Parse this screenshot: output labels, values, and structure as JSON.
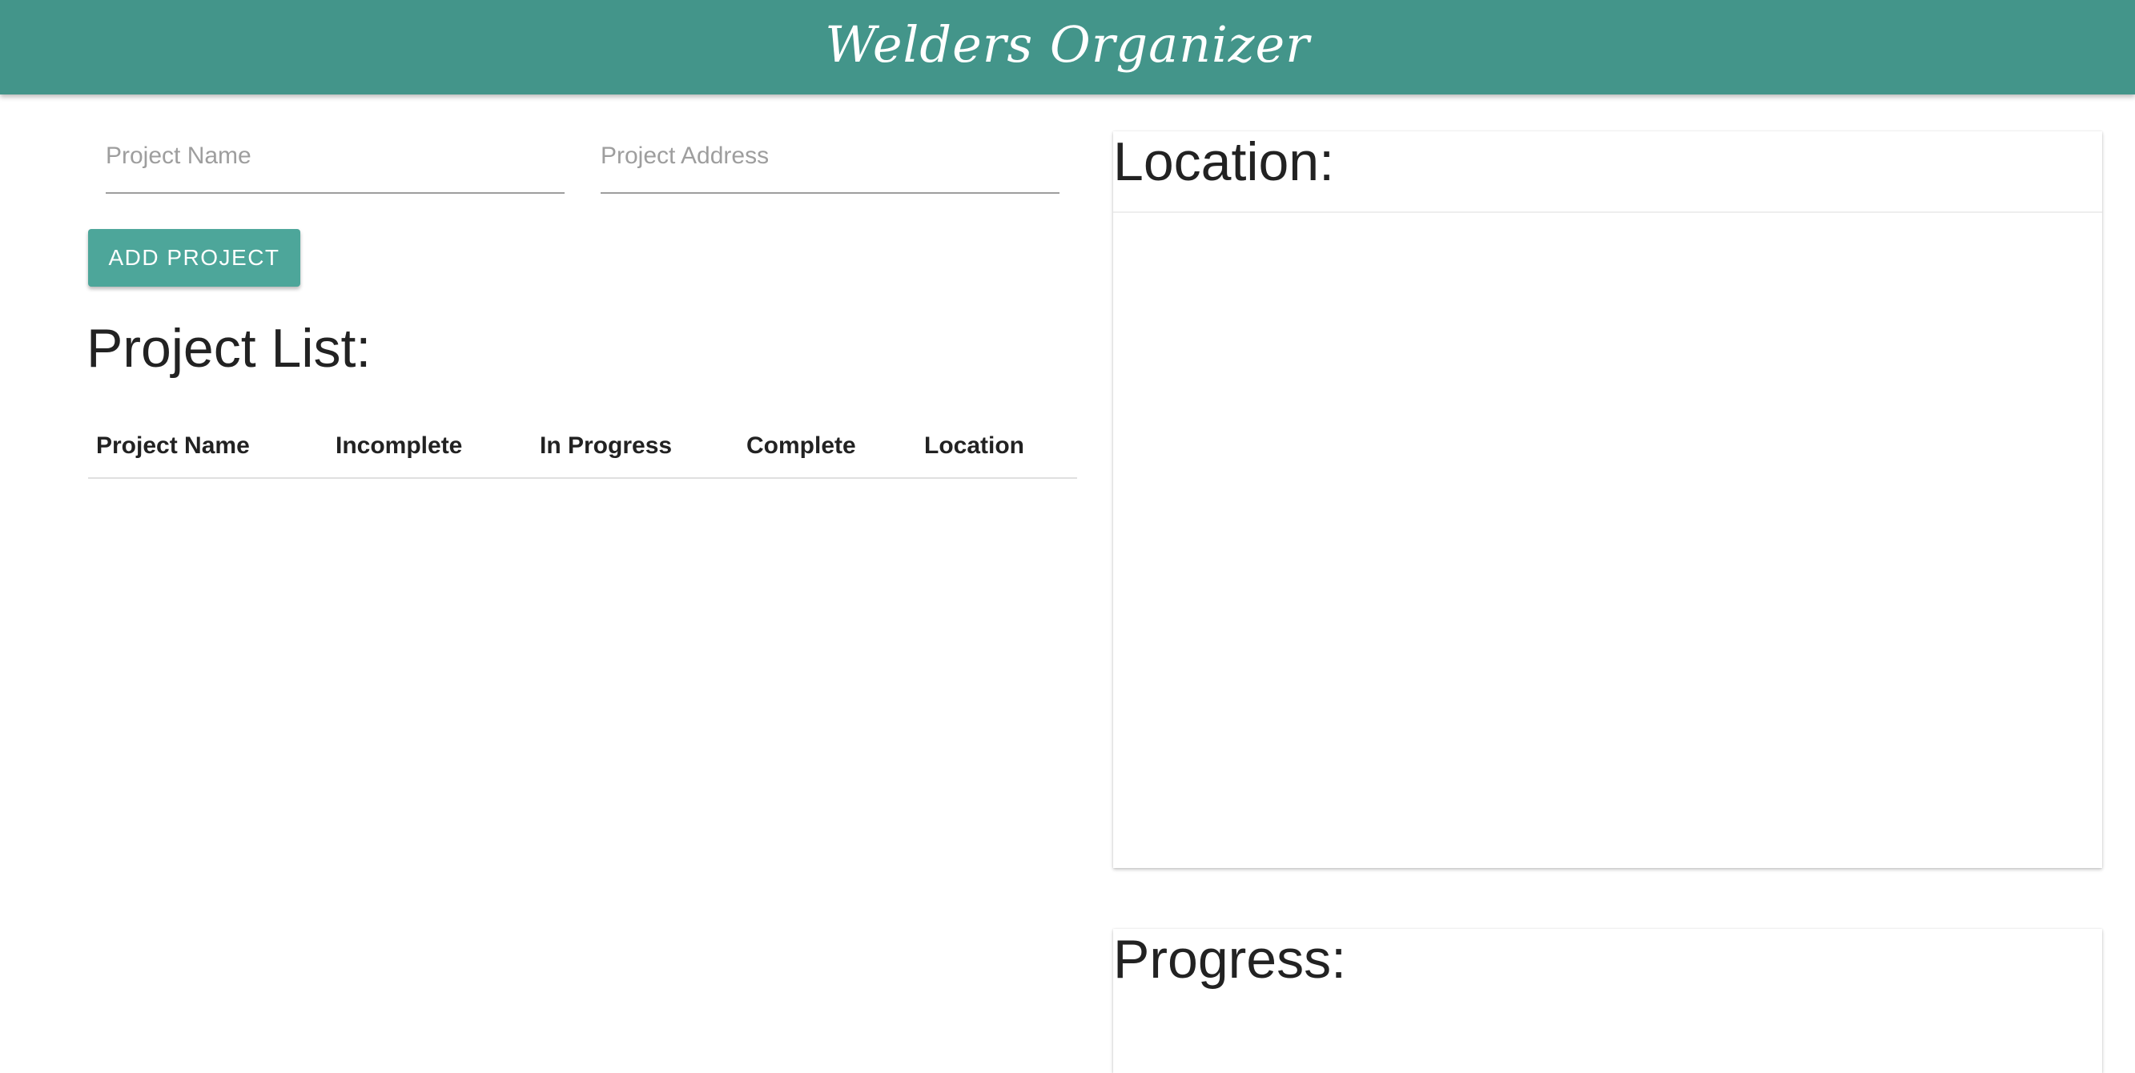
{
  "app": {
    "title": "Welders Organizer",
    "brand_color": "#43958a"
  },
  "form": {
    "project_name_placeholder": "Project Name",
    "project_name_value": "",
    "project_address_placeholder": "Project Address",
    "project_address_value": "",
    "add_button_label": "ADD PROJECT",
    "button_color": "#4da69a"
  },
  "project_list": {
    "title": "Project List:",
    "columns": [
      "Project Name",
      "Incomplete",
      "In Progress",
      "Complete",
      "Location"
    ],
    "rows": []
  },
  "cards": {
    "location_title": "Location:",
    "progress_title": "Progress:"
  }
}
